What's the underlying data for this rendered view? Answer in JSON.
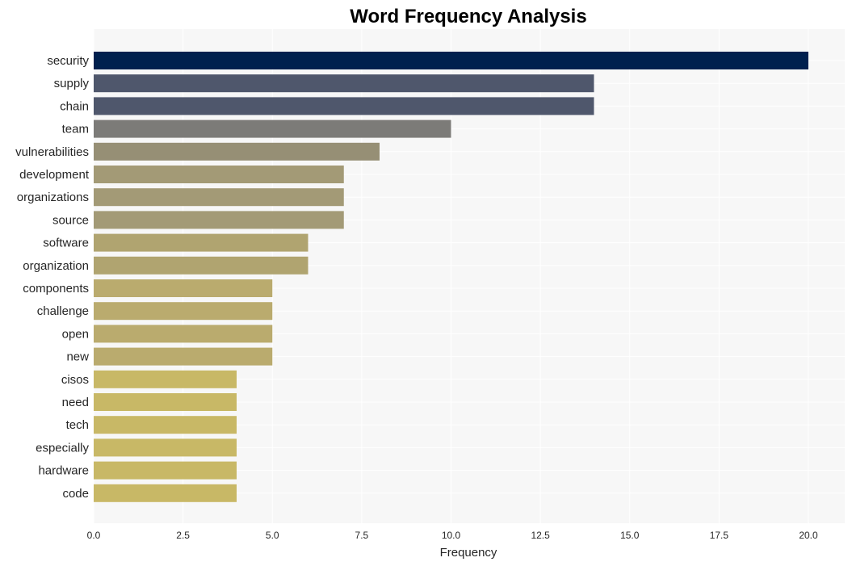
{
  "chart_data": {
    "type": "bar",
    "orientation": "horizontal",
    "title": "Word Frequency Analysis",
    "xlabel": "Frequency",
    "ylabel": "",
    "xlim": [
      0,
      21
    ],
    "xticks": [
      0,
      2.5,
      5,
      7.5,
      10,
      12.5,
      15,
      17.5,
      20
    ],
    "xtick_labels": [
      "0.0",
      "2.5",
      "5.0",
      "7.5",
      "10.0",
      "12.5",
      "15.0",
      "17.5",
      "20.0"
    ],
    "grid": true,
    "categories": [
      "security",
      "supply",
      "chain",
      "team",
      "vulnerabilities",
      "development",
      "organizations",
      "source",
      "software",
      "organization",
      "components",
      "challenge",
      "open",
      "new",
      "cisos",
      "need",
      "tech",
      "especially",
      "hardware",
      "code"
    ],
    "values": [
      20,
      14,
      14,
      10,
      8,
      7,
      7,
      7,
      6,
      6,
      5,
      5,
      5,
      5,
      4,
      4,
      4,
      4,
      4,
      4
    ],
    "colors": [
      "#00204e",
      "#4f576c",
      "#4f576c",
      "#7c7b78",
      "#968f75",
      "#a39a76",
      "#a39a76",
      "#a39a76",
      "#b0a470",
      "#b0a470",
      "#baab6e",
      "#baab6e",
      "#baab6e",
      "#baab6e",
      "#c8b866",
      "#c8b866",
      "#c8b866",
      "#c8b866",
      "#c8b866",
      "#c8b866"
    ]
  }
}
